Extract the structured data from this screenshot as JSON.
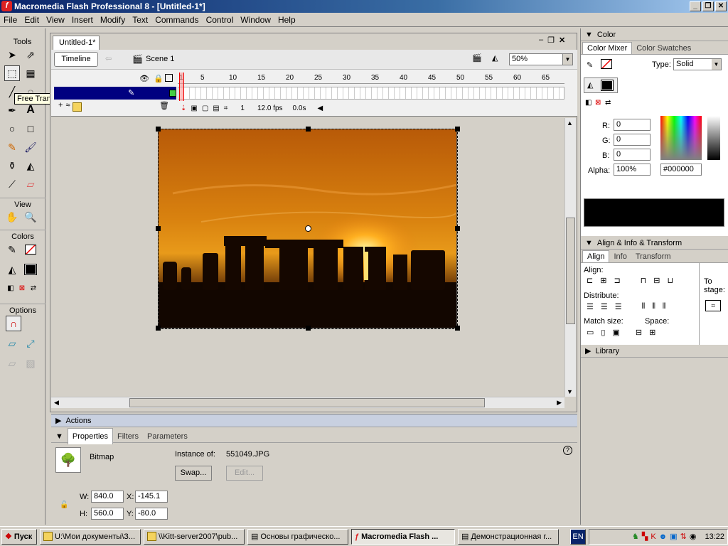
{
  "window": {
    "title": "Macromedia Flash Professional 8 - [Untitled-1*]"
  },
  "menu": [
    "File",
    "Edit",
    "View",
    "Insert",
    "Modify",
    "Text",
    "Commands",
    "Control",
    "Window",
    "Help"
  ],
  "tools": {
    "header": "Tools",
    "view_header": "View",
    "colors_header": "Colors",
    "options_header": "Options",
    "tooltip": "Free Transform Tool (Q)"
  },
  "document": {
    "tab": "Untitled-1*",
    "timeline_button": "Timeline",
    "scene": "Scene 1",
    "zoom": "50%",
    "frame_numbers": [
      "1",
      "5",
      "10",
      "15",
      "20",
      "25",
      "30",
      "35",
      "40",
      "45",
      "50",
      "55",
      "60",
      "65"
    ],
    "current_frame": "1",
    "fps": "12.0 fps",
    "time": "0.0s"
  },
  "color_panel": {
    "title": "Color",
    "tab_mixer": "Color Mixer",
    "tab_swatches": "Color Swatches",
    "type_label": "Type:",
    "type_value": "Solid",
    "r_label": "R:",
    "r": "0",
    "g_label": "G:",
    "g": "0",
    "b_label": "B:",
    "b": "0",
    "alpha_label": "Alpha:",
    "alpha": "100%",
    "hex": "#000000",
    "fill_color": "#000000"
  },
  "align_panel": {
    "title": "Align & Info & Transform",
    "tab_align": "Align",
    "tab_info": "Info",
    "tab_transform": "Transform",
    "align_label": "Align:",
    "distribute_label": "Distribute:",
    "match_label": "Match size:",
    "space_label": "Space:",
    "to_stage": "To stage:"
  },
  "library_panel": {
    "title": "Library"
  },
  "actions_panel": {
    "title": "Actions"
  },
  "properties": {
    "tab_properties": "Properties",
    "tab_filters": "Filters",
    "tab_parameters": "Parameters",
    "type": "Bitmap",
    "instance_label": "Instance of:",
    "instance_value": "551049.JPG",
    "swap": "Swap...",
    "edit": "Edit...",
    "w_label": "W:",
    "w": "840.0",
    "h_label": "H:",
    "h": "560.0",
    "x_label": "X:",
    "x": "-145.1",
    "y_label": "Y:",
    "y": "-80.0"
  },
  "taskbar": {
    "start": "Пуск",
    "items": [
      "U:\\Мои документы\\З...",
      "\\\\Kitt-server2007\\pub...",
      "Основы графическо...",
      "Macromedia Flash ...",
      "Демонстрационная г..."
    ],
    "lang": "EN",
    "clock": "13:22"
  }
}
